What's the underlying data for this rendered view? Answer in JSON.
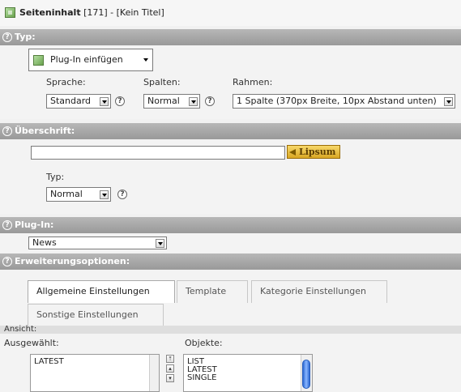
{
  "header": {
    "title_bold": "Seiteninhalt",
    "title_rest": " [171] - [Kein Titel]"
  },
  "sections": {
    "typ": "Typ:",
    "ueberschrift": "Überschrift:",
    "plugin": "Plug-In:",
    "erweiterung": "Erweiterungsoptionen:"
  },
  "help_glyph": "?",
  "typ": {
    "select_value": "Plug-In einfügen",
    "sprache_label": "Sprache:",
    "sprache_value": "Standard",
    "spalten_label": "Spalten:",
    "spalten_value": "Normal",
    "rahmen_label": "Rahmen:",
    "rahmen_value": "1 Spalte (370px Breite, 10px Abstand unten)"
  },
  "ueberschrift": {
    "input_value": "",
    "lipsum_label": "Lipsum",
    "typ_label": "Typ:",
    "typ_value": "Normal"
  },
  "plugin": {
    "value": "News"
  },
  "tabs": [
    {
      "label": "Allgemeine Einstellungen",
      "active": true
    },
    {
      "label": "Template",
      "active": false
    },
    {
      "label": "Kategorie Einstellungen",
      "active": false
    },
    {
      "label": "Sonstige Einstellungen",
      "active": false
    }
  ],
  "options": {
    "ansicht_label": "Ansicht:",
    "ausgewaehlt_label": "Ausgewählt:",
    "objekte_label": "Objekte:",
    "selected_items": [
      "LATEST"
    ],
    "object_items": [
      "LIST",
      "LATEST",
      "SINGLE"
    ]
  },
  "colors": {
    "section_bar": "#a8a8a8",
    "lipsum": "#e6b93b",
    "scroll_knob": "#2d68d3"
  }
}
